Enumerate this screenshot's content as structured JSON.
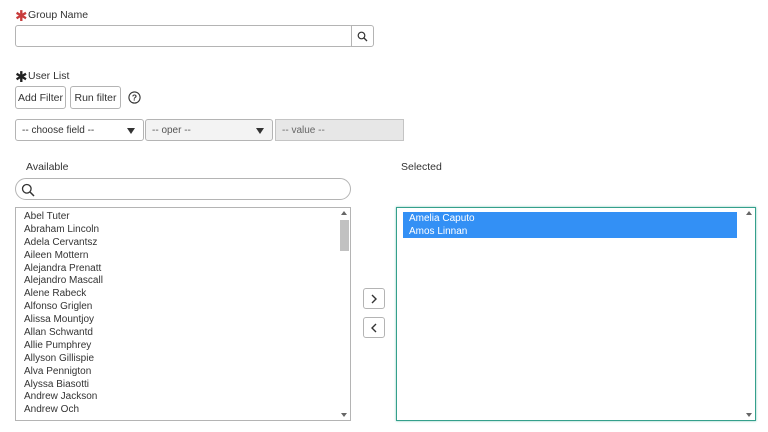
{
  "group_name": {
    "label": "Group Name",
    "value": "",
    "search_icon": "magnifier-icon"
  },
  "user_list": {
    "label": "User List",
    "add_filter_label": "Add Filter",
    "run_filter_label": "Run filter",
    "help_icon": "question-circle-icon",
    "field_select": "-- choose field --",
    "oper_select": "-- oper --",
    "value_placeholder": "-- value --"
  },
  "available": {
    "heading": "Available",
    "search_value": "",
    "items": [
      "Abel Tuter",
      "Abraham Lincoln",
      "Adela Cervantsz",
      "Aileen Mottern",
      "Alejandra Prenatt",
      "Alejandro Mascall",
      "Alene Rabeck",
      "Alfonso Griglen",
      "Alissa Mountjoy",
      "Allan Schwantd",
      "Allie Pumphrey",
      "Allyson Gillispie",
      "Alva Pennigton",
      "Alyssa Biasotti",
      "Andrew Jackson",
      "Andrew Och"
    ]
  },
  "selected": {
    "heading": "Selected",
    "items": [
      "Amelia Caputo",
      "Amos Linnan"
    ]
  },
  "colors": {
    "selection": "#3390f5",
    "focus_border": "#35a08c",
    "required_red": "#c83c3c"
  }
}
